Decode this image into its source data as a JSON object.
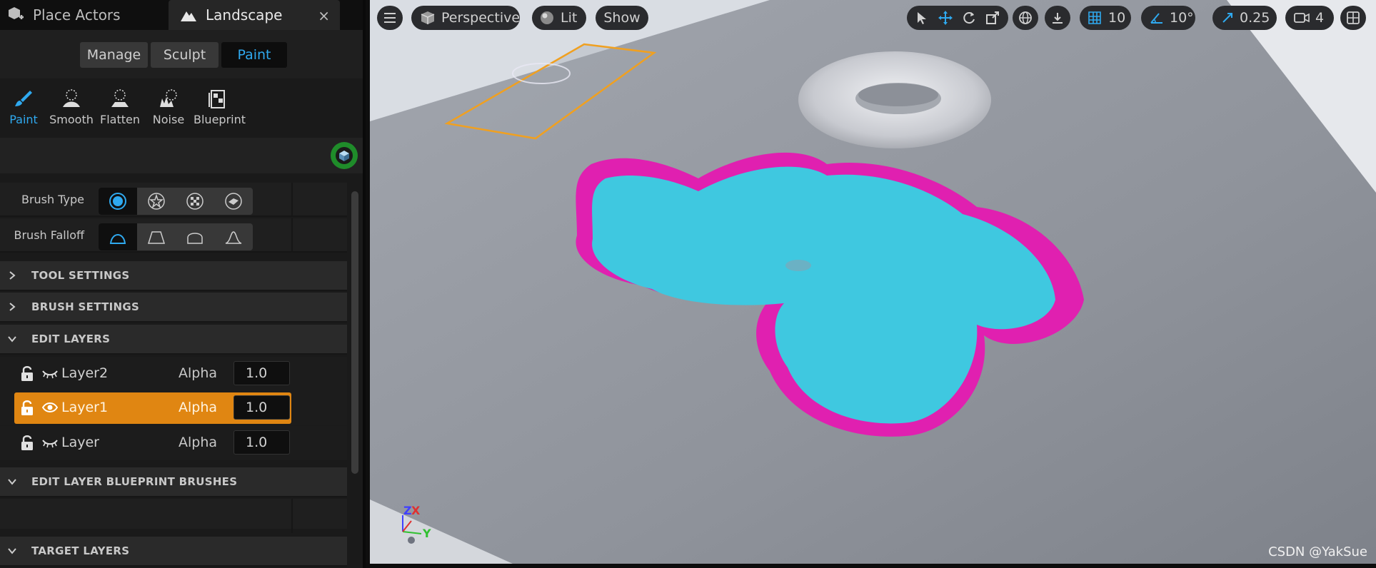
{
  "tabs": {
    "place_actors": "Place Actors",
    "landscape": "Landscape",
    "close": "×"
  },
  "modes": {
    "manage": "Manage",
    "sculpt": "Sculpt",
    "paint": "Paint"
  },
  "tools": [
    {
      "label": "Paint",
      "icon": "brush-icon",
      "active": true
    },
    {
      "label": "Smooth",
      "icon": "smooth-icon",
      "active": false
    },
    {
      "label": "Flatten",
      "icon": "flatten-icon",
      "active": false
    },
    {
      "label": "Noise",
      "icon": "noise-icon",
      "active": false
    },
    {
      "label": "Blueprint",
      "icon": "blueprint-icon",
      "active": false
    }
  ],
  "brush": {
    "type_label": "Brush Type",
    "falloff_label": "Brush Falloff"
  },
  "sections": {
    "tool_settings": "TOOL SETTINGS",
    "brush_settings": "BRUSH SETTINGS",
    "edit_layers": "EDIT LAYERS",
    "blueprint_brushes": "EDIT LAYER BLUEPRINT BRUSHES",
    "target_layers": "TARGET LAYERS"
  },
  "layers": [
    {
      "name": "Layer2",
      "alpha_label": "Alpha",
      "alpha": "1.0",
      "selected": false,
      "visible": false
    },
    {
      "name": "Layer1",
      "alpha_label": "Alpha",
      "alpha": "1.0",
      "selected": true,
      "visible": true
    },
    {
      "name": "Layer",
      "alpha_label": "Alpha",
      "alpha": "1.0",
      "selected": false,
      "visible": false
    }
  ],
  "viewport": {
    "view_mode": "Perspective",
    "lighting": "Lit",
    "show": "Show",
    "grid_snap": "10",
    "rotation_snap": "10°",
    "scale_snap": "0.25",
    "camera_speed": "4",
    "axis_z": "Z",
    "axis_x": "X",
    "axis_y": "Y",
    "watermark": "CSDN @YakSue"
  },
  "colors": {
    "accent_blue": "#2fa9ef",
    "selected_orange": "#e08612",
    "paint_cyan": "#3fc8e0",
    "paint_magenta": "#e020b0"
  }
}
